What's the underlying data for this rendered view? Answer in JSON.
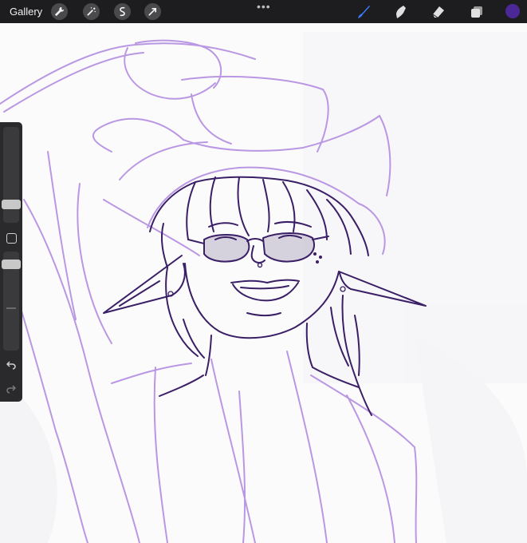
{
  "app": {
    "gallery_label": "Gallery"
  },
  "toolbar": {
    "left_tools": [
      "wrench-icon",
      "magic-wand-icon",
      "selection-icon",
      "transform-arrow-icon"
    ],
    "more_icon": "more-dots-icon",
    "right_tools": [
      "brush-icon",
      "smudge-icon",
      "eraser-icon",
      "layers-icon"
    ],
    "active_tool": "brush-icon",
    "accent_color": "#3b7bff",
    "current_color": "#4b2896"
  },
  "sidebar": {
    "brush_size_level": 0.32,
    "opacity_level": 0.15,
    "modify_button_icon": "square-icon",
    "undo_icon": "undo-icon",
    "redo_icon": "redo-icon"
  },
  "canvas": {
    "sketch_color": "#b28bdc",
    "lineart_color": "#3a1f66"
  }
}
